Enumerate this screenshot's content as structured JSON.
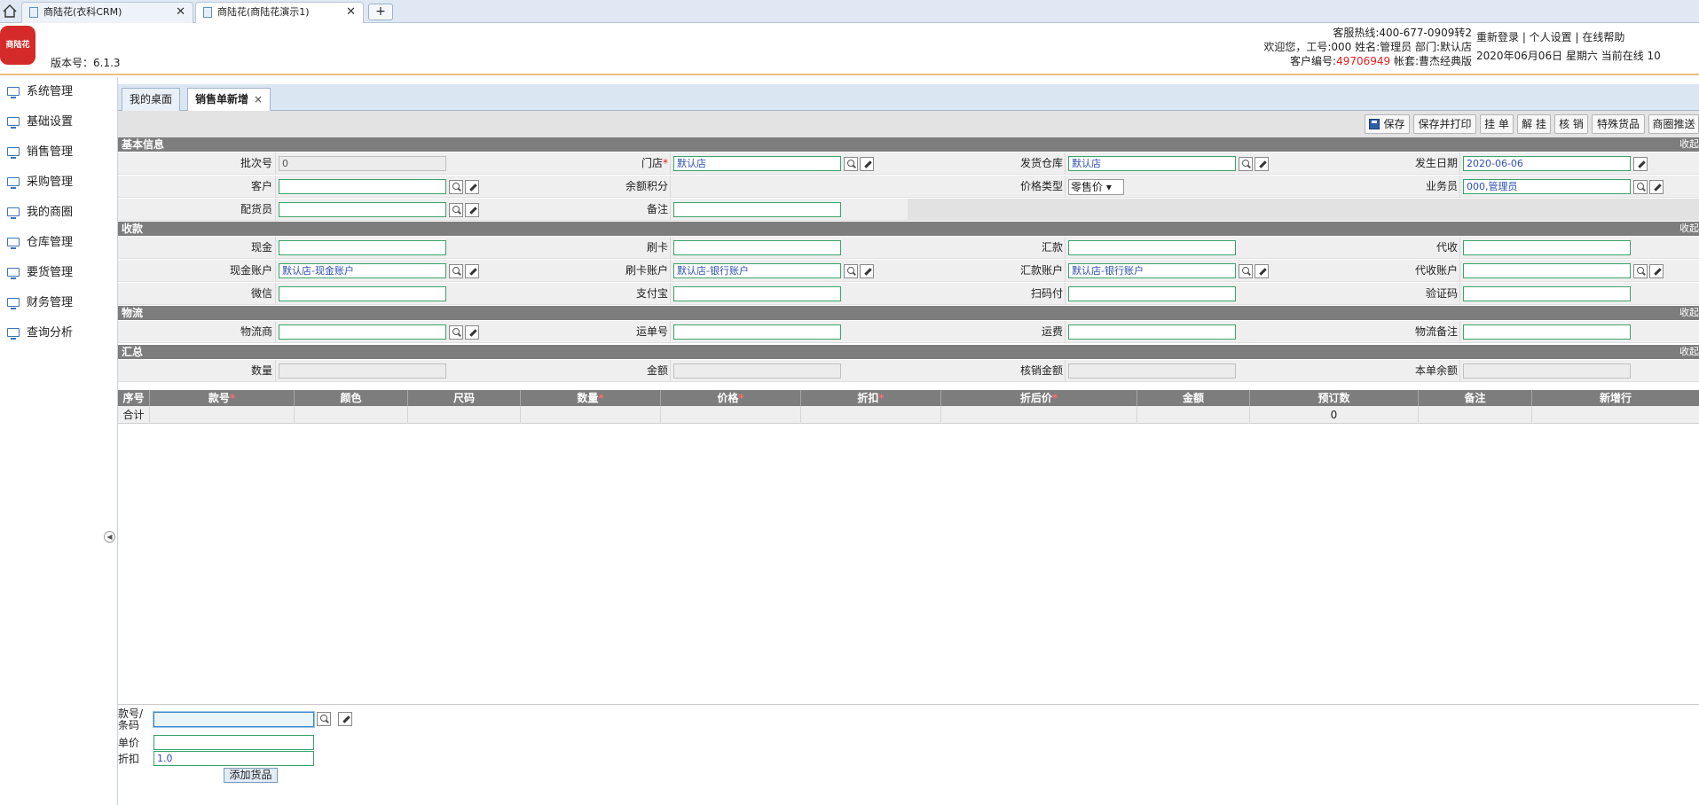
{
  "browser": {
    "tabs": [
      {
        "label": "商陆花(衣科CRM)",
        "close": "✕"
      },
      {
        "label": "商陆花(商陆花演示1)",
        "close": "✕"
      }
    ],
    "new_tab": "+"
  },
  "header": {
    "logo_text": "商陆花",
    "version": "版本号：6.1.3",
    "hotline": "客服热线:400-677-0909转2",
    "welcome": "欢迎您，工号:000 姓名:管理员 部门:默认店",
    "customer_prefix": "客户编号:",
    "customer_no": "49706949",
    "account": " 帐套:曹杰经典版",
    "links": "重新登录 | 个人设置 | 在线帮助",
    "datetime": "2020年06月06日 星期六 当前在线 10"
  },
  "sidebar": {
    "items": [
      "系统管理",
      "基础设置",
      "销售管理",
      "采购管理",
      "我的商圈",
      "仓库管理",
      "要货管理",
      "财务管理",
      "查询分析"
    ]
  },
  "app_tabs": [
    {
      "label": "我的桌面"
    },
    {
      "label": "销售单新增",
      "close": "×"
    }
  ],
  "toolbar": {
    "save": "保存",
    "save_print": "保存并打印",
    "hang": "挂 单",
    "unhang": "解 挂",
    "verify": "核 销",
    "special": "特殊货品",
    "push": "商圈推送"
  },
  "sections": {
    "basic": "基本信息",
    "payment": "收款",
    "logistics": "物流",
    "summary": "汇总",
    "fold": "收起"
  },
  "basic": {
    "batch_label": "批次号",
    "batch_value": "0",
    "store_label": "门店",
    "store_req": "*",
    "store_value": "默认店",
    "warehouse_label": "发货仓库",
    "warehouse_value": "默认店",
    "date_label": "发生日期",
    "date_value": "2020-06-06",
    "customer_label": "客户",
    "customer_value": "",
    "balance_label": "余额积分",
    "price_type_label": "价格类型",
    "price_type_value": "零售价 ▾",
    "salesman_label": "业务员",
    "salesman_value": "000,管理员",
    "picker_label": "配货员",
    "picker_value": "",
    "remark_label": "备注",
    "remark_value": ""
  },
  "payment": {
    "cash_label": "现金",
    "card_label": "刷卡",
    "remit_label": "汇款",
    "collect_label": "代收",
    "cash_acct_label": "现金账户",
    "cash_acct_value": "默认店-现金账户",
    "card_acct_label": "刷卡账户",
    "card_acct_value": "默认店-银行账户",
    "remit_acct_label": "汇款账户",
    "remit_acct_value": "默认店-银行账户",
    "collect_acct_label": "代收账户",
    "collect_acct_value": "",
    "wechat_label": "微信",
    "alipay_label": "支付宝",
    "scan_label": "扫码付",
    "code_label": "验证码"
  },
  "logistics": {
    "carrier_label": "物流商",
    "waybill_label": "运单号",
    "freight_label": "运费",
    "remark_label": "物流备注"
  },
  "summary": {
    "qty_label": "数量",
    "amount_label": "金额",
    "verify_label": "核销金额",
    "balance_label": "本单余额"
  },
  "grid": {
    "headers": [
      {
        "label": "序号",
        "req": ""
      },
      {
        "label": "款号",
        "req": "*"
      },
      {
        "label": "颜色",
        "req": ""
      },
      {
        "label": "尺码",
        "req": ""
      },
      {
        "label": "数量",
        "req": "*"
      },
      {
        "label": "价格",
        "req": "*"
      },
      {
        "label": "折扣",
        "req": "*"
      },
      {
        "label": "折后价",
        "req": "*"
      },
      {
        "label": "金额",
        "req": ""
      },
      {
        "label": "预订数",
        "req": ""
      },
      {
        "label": "备注",
        "req": ""
      },
      {
        "label": "新增行",
        "req": ""
      }
    ],
    "total_label": "合计",
    "total_reserved": "0"
  },
  "bottom": {
    "style_label_1": "款号/",
    "style_label_2": "条码",
    "style_value": "",
    "price_label": "单价",
    "price_value": "",
    "discount_label": "折扣",
    "discount_value": "1.0",
    "add_button": "添加货品"
  },
  "colors": {
    "accent": "#d42a2a",
    "customer_no": "#e02020",
    "section_bg": "#7d7d7d",
    "field_border": "#39a36b"
  }
}
